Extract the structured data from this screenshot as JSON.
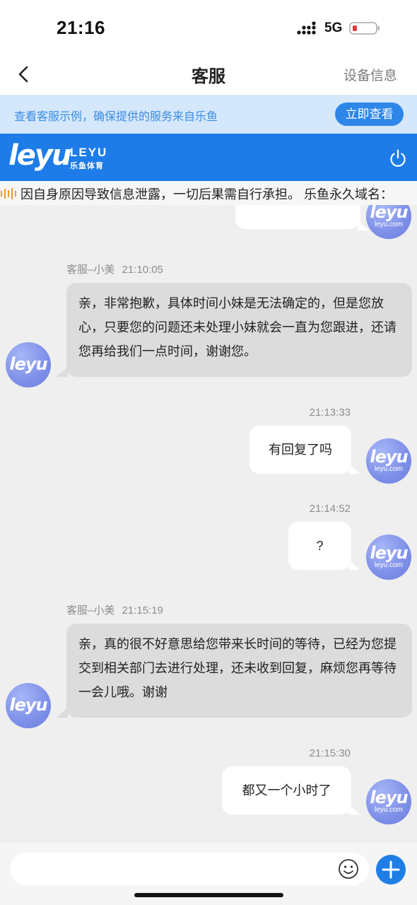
{
  "status_bar": {
    "time": "21:16",
    "network": "5G",
    "battery_color": "#e03b3b"
  },
  "nav": {
    "title": "客服",
    "device_info_label": "设备信息",
    "back_icon": "chevron-left-icon"
  },
  "notice": {
    "text": "查看客服示例，确保提供的服务来自乐鱼",
    "button_label": "立即查看"
  },
  "brand": {
    "logo_text": "leyu",
    "latin_name": "LEYU",
    "cn_name": "乐鱼体育",
    "power_icon": "power-icon",
    "color": "#1d7ce8"
  },
  "marquee": {
    "text": "因自身原因导致信息泄露，一切后果需自行承担。 乐鱼永久域名："
  },
  "avatars": {
    "agent_logo": "leyu",
    "user_logo": "leyu",
    "user_sub": "leyu.com"
  },
  "messages": [
    {
      "sender": "客服–小美",
      "time": "21:10:05",
      "text": "亲，非常抱歉，具体时间小妹是无法确定的，但是您放心，只要您的问题还未处理小妹就会一直为您跟进，还请您再给我们一点时间，谢谢您。"
    },
    {
      "time": "21:13:33",
      "text": "有回复了吗"
    },
    {
      "time": "21:14:52",
      "text": "?"
    },
    {
      "sender": "客服–小美",
      "time": "21:15:19",
      "text": "亲，真的很不好意思给您带来长时间的等待，已经为您提交到相关部门去进行处理，还未收到回复，麻烦您再等待一会儿哦。谢谢"
    },
    {
      "time": "21:15:30",
      "text": "都又一个小时了"
    }
  ],
  "input": {
    "placeholder": "",
    "emoji_icon": "smiley-icon",
    "add_icon": "plus-icon",
    "accent": "#1f7ee6"
  }
}
